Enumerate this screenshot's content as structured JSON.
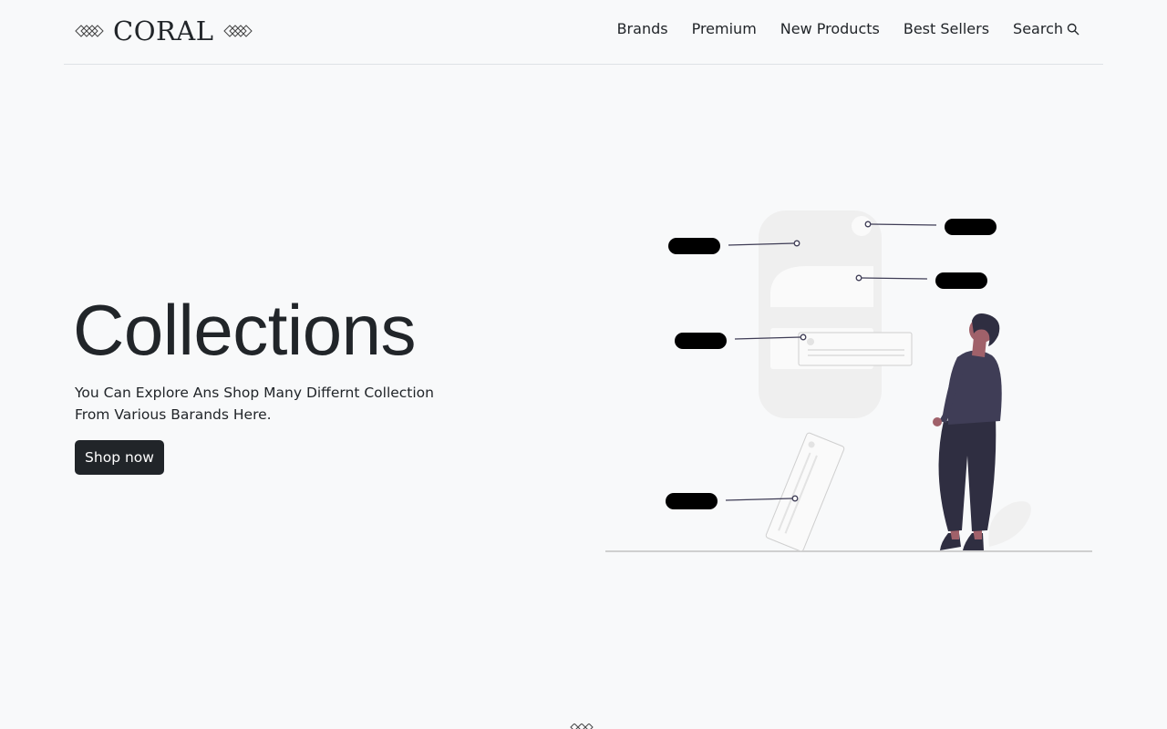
{
  "header": {
    "brand": "CORAL",
    "nav": [
      {
        "label": "Brands",
        "icon": null
      },
      {
        "label": "Premium",
        "icon": null
      },
      {
        "label": "New Products",
        "icon": null
      },
      {
        "label": "Best Sellers",
        "icon": null
      },
      {
        "label": "Search",
        "icon": "search-icon"
      }
    ]
  },
  "hero": {
    "title": "Collections",
    "description_line1": "You Can Explore Ans Shop Many Differnt Collection",
    "description_line2": "From Various Barands Here.",
    "cta_label": "Shop now"
  },
  "colors": {
    "background": "#f8f9fa",
    "text": "#212529",
    "button_bg": "#212529",
    "person_accent": "#3f3d56",
    "skin": "#a0616a"
  }
}
